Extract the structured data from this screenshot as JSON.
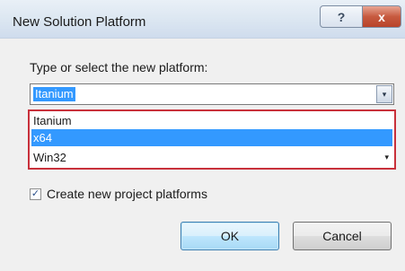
{
  "window": {
    "title": "New Solution Platform",
    "help_glyph": "?",
    "close_glyph": "x"
  },
  "form": {
    "prompt": "Type or select the new platform:",
    "combo_value": "Itanium",
    "combo_arrow_glyph": "▾",
    "options": [
      {
        "label": "Itanium",
        "selected": false
      },
      {
        "label": "x64",
        "selected": true
      },
      {
        "label": "Win32",
        "selected": false
      }
    ],
    "checkbox_label": "Create new project platforms",
    "checkbox_checked": true,
    "checkbox_glyph": "✓"
  },
  "buttons": {
    "ok_label": "OK",
    "cancel_label": "Cancel"
  },
  "colors": {
    "selection": "#3399ff",
    "highlight_border": "#c8303a",
    "close_button": "#c75a3f"
  }
}
